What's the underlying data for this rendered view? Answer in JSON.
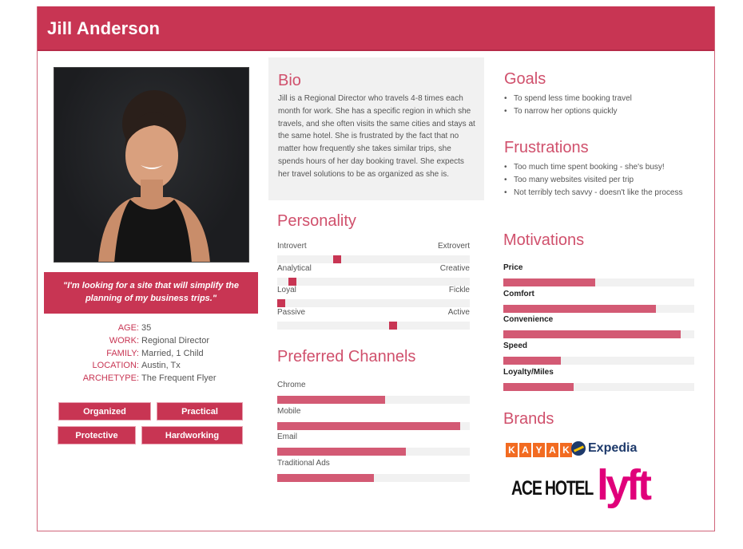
{
  "header": {
    "title": "Jill Anderson"
  },
  "colors": {
    "accent": "#c83553",
    "bar": "#d35a74",
    "track": "#f1f1f1",
    "heading": "#d0506c"
  },
  "profile": {
    "photo_alt": "portrait-photo",
    "quote_line1": "\"I'm looking for a site that will simplify the",
    "quote_line2": "planning of my business trips.\"",
    "facts": [
      {
        "key": "AGE:",
        "value": "35"
      },
      {
        "key": "WORK:",
        "value": "Regional Director"
      },
      {
        "key": "FAMILY:",
        "value": "Married, 1 Child"
      },
      {
        "key": "LOCATION:",
        "value": "Austin, Tx"
      },
      {
        "key": "ARCHETYPE:",
        "value": "The Frequent Flyer"
      }
    ],
    "traits": [
      "Organized",
      "Practical",
      "Protective",
      "Hardworking"
    ]
  },
  "bio": {
    "title": "Bio",
    "text": "Jill is a Regional Director who travels 4-8 times each month for work. She has a specific region in which she travels, and she often visits the same cities and stays at the same hotel. She is frustrated by the fact that no matter how frequently she takes similar trips, she spends hours of her day booking travel. She expects her travel solutions to be as organized as she is."
  },
  "personality": {
    "title": "Personality",
    "scales": [
      {
        "left": "Introvert",
        "right": "Extrovert",
        "value": 0.31
      },
      {
        "left": "Analytical",
        "right": "Creative",
        "value": 0.08
      },
      {
        "left": "Loyal",
        "right": "Fickle",
        "value": 0.02
      },
      {
        "left": "Passive",
        "right": "Active",
        "value": 0.6
      }
    ]
  },
  "channels": {
    "title": "Preferred Channels",
    "items": [
      {
        "label": "Chrome",
        "value": 0.56
      },
      {
        "label": "Mobile",
        "value": 0.95
      },
      {
        "label": "Email",
        "value": 0.67
      },
      {
        "label": "Traditional Ads",
        "value": 0.5
      }
    ]
  },
  "goals": {
    "title": "Goals",
    "items": [
      "To spend less time booking travel",
      "To narrow her options quickly"
    ]
  },
  "frustrations": {
    "title": "Frustrations",
    "items": [
      "Too much time spent booking - she's busy!",
      "Too many websites visited per trip",
      "Not terribly tech savvy - doesn't like the process"
    ]
  },
  "motivations": {
    "title": "Motivations",
    "items": [
      {
        "label": "Price",
        "value": 0.48
      },
      {
        "label": "Comfort",
        "value": 0.8
      },
      {
        "label": "Convenience",
        "value": 0.93
      },
      {
        "label": "Speed",
        "value": 0.3
      },
      {
        "label": "Loyalty/Miles",
        "value": 0.37
      }
    ]
  },
  "brands": {
    "title": "Brands",
    "kayak_letters": [
      "K",
      "A",
      "Y",
      "A",
      "K"
    ],
    "expedia": "Expedia",
    "acehotel": "ACE HOTEL",
    "lyft": "lyft"
  }
}
